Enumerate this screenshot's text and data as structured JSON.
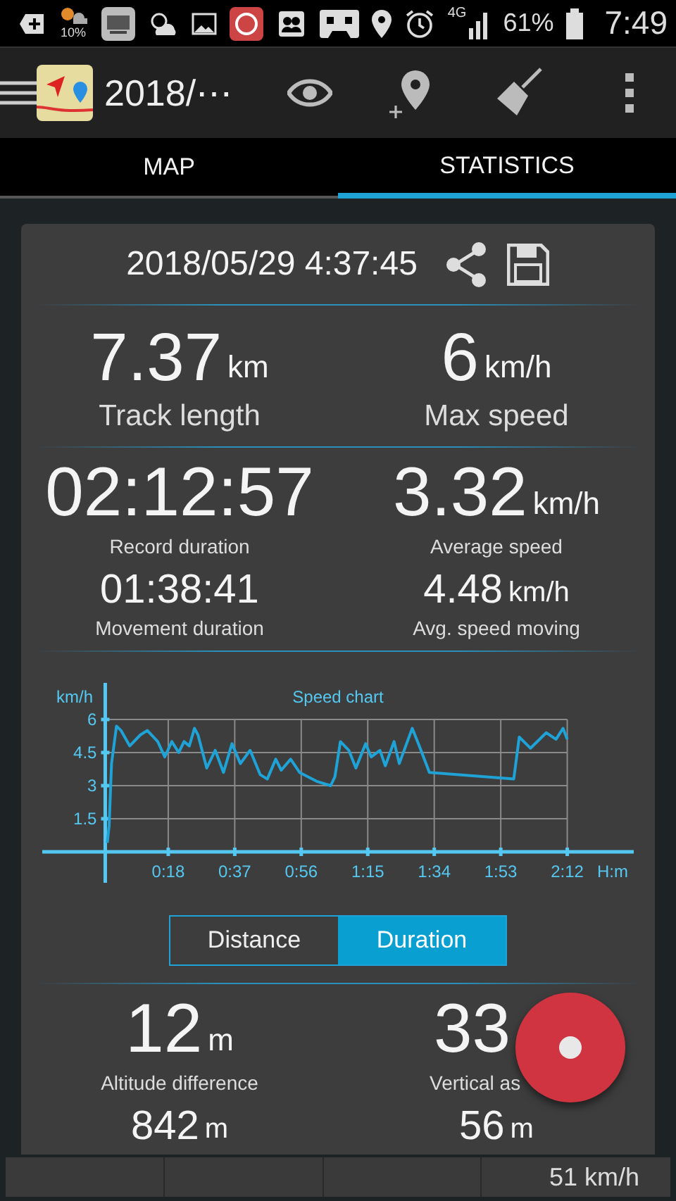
{
  "status_bar": {
    "weather_text": "10%",
    "network": "4G",
    "battery": "61%",
    "time": "7:49"
  },
  "toolbar": {
    "title": "2018/⋯"
  },
  "tabs": [
    {
      "label": "MAP",
      "selected": false
    },
    {
      "label": "STATISTICS",
      "selected": true
    }
  ],
  "card": {
    "date": "2018/05/29 4:37:45",
    "blocks": [
      {
        "kind": "large",
        "items": [
          {
            "value": "7.37",
            "unit": "km",
            "label": "Track length"
          },
          {
            "value": "6",
            "unit": "km/h",
            "label": "Max speed"
          }
        ]
      },
      {
        "kind": "primary",
        "items": [
          {
            "value": "02:12:57",
            "label": "Record duration"
          },
          {
            "value": "3.32",
            "unit": "km/h",
            "label": "Average speed"
          }
        ]
      },
      {
        "kind": "secondary",
        "items": [
          {
            "value": "01:38:41",
            "label": "Movement duration"
          },
          {
            "value": "4.48",
            "unit": "km/h",
            "label": "Avg. speed moving"
          }
        ]
      },
      {
        "kind": "chart",
        "chart_data": {
          "type": "line",
          "title": "Speed chart",
          "xlabel": "H:m",
          "ylabel": "km/h",
          "xlim": [
            -18,
            151
          ],
          "ylim": [
            0,
            6
          ],
          "grid": true,
          "xticks": [
            {
              "value": 18,
              "label": "0:18"
            },
            {
              "value": 37,
              "label": "0:37"
            },
            {
              "value": 56,
              "label": "0:56"
            },
            {
              "value": 75,
              "label": "1:15"
            },
            {
              "value": 94,
              "label": "1:34"
            },
            {
              "value": 113,
              "label": "1:53"
            },
            {
              "value": 132,
              "label": "2:12"
            }
          ],
          "yticks": [
            1.5,
            3,
            4.5,
            6
          ],
          "x": [
            0.6,
            1.1,
            1.8,
            3.2,
            4.5,
            7,
            10,
            12,
            15,
            17,
            19,
            21,
            22.5,
            24,
            25.5,
            26.5,
            29,
            31.4,
            33.8,
            36.2,
            38.6,
            41.4,
            44.3,
            46.3,
            48.7,
            50.3,
            53,
            55.5,
            60.4,
            64.4,
            65.6,
            67.2,
            69.6,
            71.6,
            74.4,
            76,
            78.5,
            80,
            82.5,
            84,
            87.7,
            89.7,
            92.6,
            116.7,
            118.3,
            121.5,
            126,
            128.8,
            130.8,
            132
          ],
          "series": [
            {
              "color": "#1fa3d6",
              "values": [
                0.4,
                1.2,
                4.0,
                5.7,
                5.5,
                4.8,
                5.3,
                5.5,
                5.0,
                4.3,
                5.0,
                4.5,
                5.0,
                4.8,
                5.6,
                5.3,
                3.8,
                4.6,
                3.6,
                4.9,
                4.0,
                4.6,
                3.5,
                3.3,
                4.2,
                3.7,
                4.2,
                3.6,
                3.2,
                3.0,
                3.4,
                5.0,
                4.6,
                3.8,
                4.9,
                4.3,
                4.6,
                3.9,
                5.0,
                4.0,
                5.6,
                4.8,
                3.6,
                3.3,
                5.2,
                4.7,
                5.4,
                5.1,
                5.6,
                5.1
              ]
            }
          ]
        }
      },
      {
        "kind": "toggle",
        "options": [
          {
            "label": "Distance",
            "selected": false
          },
          {
            "label": "Duration",
            "selected": true
          }
        ]
      },
      {
        "kind": "primary",
        "items": [
          {
            "value": "12",
            "unit": "m",
            "label": "Altitude difference"
          },
          {
            "value": "33",
            "label": "Vertical as"
          }
        ]
      },
      {
        "kind": "secondary",
        "items": [
          {
            "value": "842",
            "unit": "m"
          },
          {
            "value": "56",
            "unit": "m"
          }
        ]
      }
    ]
  },
  "bottom_bar": {
    "speed": "51 km/h"
  }
}
